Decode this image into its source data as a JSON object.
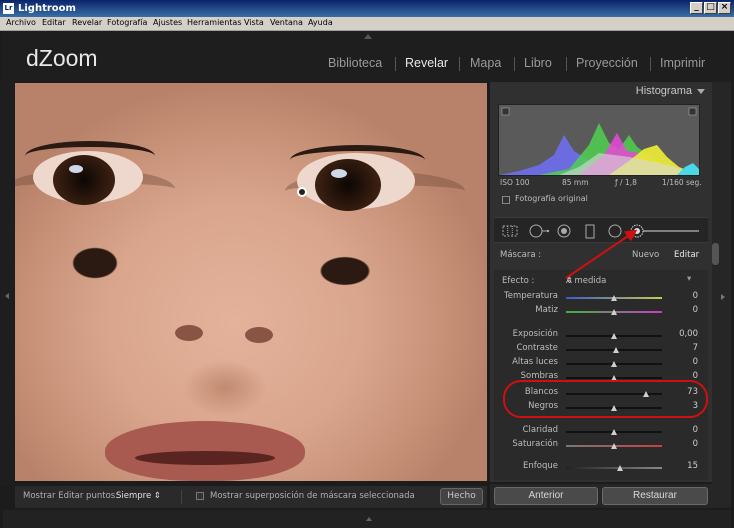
{
  "window": {
    "title": "Lightroom",
    "logo": "Lr",
    "controls": {
      "minimize": "_",
      "maximize": "□",
      "close": "×"
    }
  },
  "menu": [
    "Archivo",
    "Editar",
    "Revelar",
    "Fotografía",
    "Ajustes",
    "Herramientas",
    "Vista",
    "Ventana",
    "Ayuda"
  ],
  "identity_plate": "dZoom",
  "modules": [
    {
      "label": "Biblioteca",
      "active": false
    },
    {
      "label": "Revelar",
      "active": true
    },
    {
      "label": "Mapa",
      "active": false
    },
    {
      "label": "Libro",
      "active": false
    },
    {
      "label": "Proyección",
      "active": false
    },
    {
      "label": "Imprimir",
      "active": false
    }
  ],
  "toolbar": {
    "show_pins_label": "Mostrar Editar puntos:",
    "show_pins_value": "Siempre",
    "overlay_label": "Mostrar superposición de máscara seleccionada",
    "overlay_checked": false,
    "done_label": "Hecho"
  },
  "histogram": {
    "title": "Histograma",
    "iso": "ISO 100",
    "focal": "85 mm",
    "aperture": "ƒ / 1,8",
    "shutter": "1/160 seg.",
    "original_label": "Fotografía original",
    "original_checked": false
  },
  "mask": {
    "label": "Máscara :",
    "new_label": "Nuevo",
    "edit_label": "Editar"
  },
  "effect": {
    "label": "Efecto :",
    "value": "A medida"
  },
  "adjustments": [
    {
      "label": "Temperatura",
      "value": "0",
      "pos": 0.5,
      "grad": "temp"
    },
    {
      "label": "Matiz",
      "value": "0",
      "pos": 0.5,
      "grad": "tint"
    },
    {
      "label": "Exposición",
      "value": "0,00",
      "pos": 0.5
    },
    {
      "label": "Contraste",
      "value": "7",
      "pos": 0.53
    },
    {
      "label": "Altas luces",
      "value": "0",
      "pos": 0.5
    },
    {
      "label": "Sombras",
      "value": "0",
      "pos": 0.5
    },
    {
      "label": "Blancos",
      "value": "73",
      "pos": 0.84
    },
    {
      "label": "Negros",
      "value": "3",
      "pos": 0.51
    },
    {
      "label": "Claridad",
      "value": "0",
      "pos": 0.5
    },
    {
      "label": "Saturación",
      "value": "0",
      "pos": 0.5,
      "grad": "sat"
    },
    {
      "label": "Enfoque",
      "value": "15",
      "pos": 0.57,
      "grad": "sharp"
    }
  ],
  "buttons": {
    "previous": "Anterior",
    "reset": "Restaurar"
  },
  "colors": {
    "annotation_red": "#d01010",
    "panel_bg": "#303030"
  }
}
